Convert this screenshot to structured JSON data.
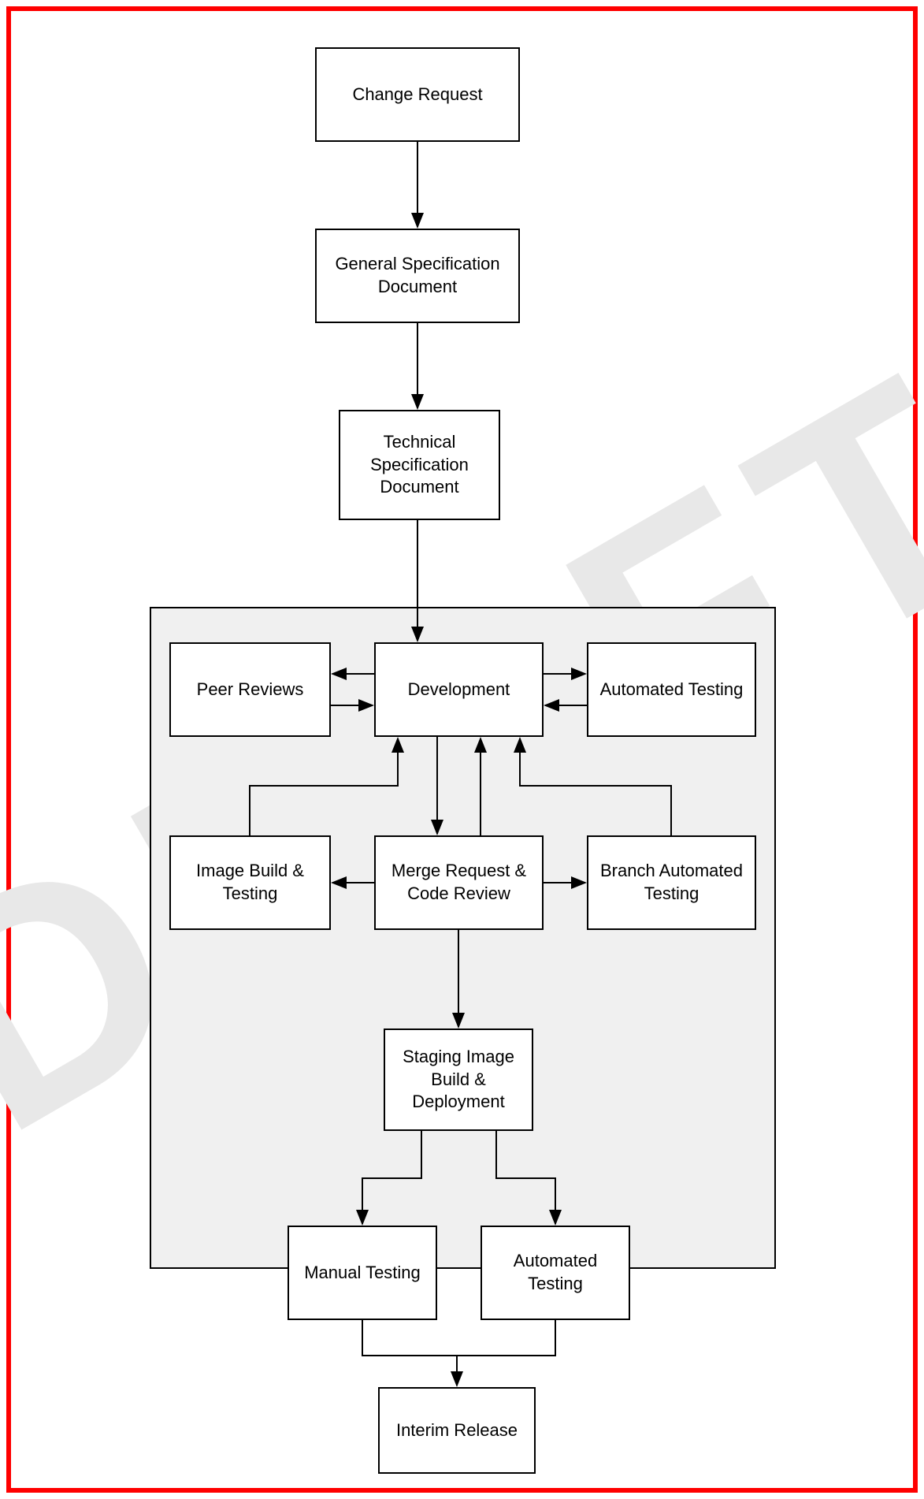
{
  "watermark": "DRAFT",
  "nodes": {
    "change_request": "Change Request",
    "general_spec": "General Specification Document",
    "tech_spec": "Technical Specification Document",
    "peer_reviews": "Peer Reviews",
    "development": "Development",
    "auto_testing_top": "Automated Testing",
    "image_build_testing": "Image Build & Testing",
    "merge_request": "Merge Request & Code Review",
    "branch_auto_testing": "Branch Automated Testing",
    "staging": "Staging Image Build & Deployment",
    "manual_testing": "Manual Testing",
    "auto_testing_bottom": "Automated Testing",
    "interim_release": "Interim Release"
  }
}
